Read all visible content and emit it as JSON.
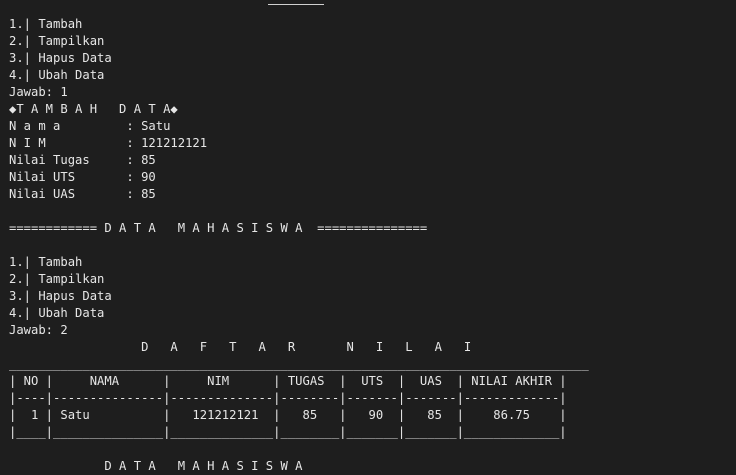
{
  "terminal": {
    "lines": [
      "1.| Tambah",
      "2.| Tampilkan",
      "3.| Hapus Data",
      "4.| Ubah Data",
      "Jawab: 1",
      "◆T A M B A H   D A T A◆",
      "N a m a         : Satu",
      "N I M           : 121212121",
      "Nilai Tugas     : 85",
      "Nilai UTS       : 90",
      "Nilai UAS       : 85",
      "",
      "============ D A T A   M A H A S I S W A  ===============",
      "",
      "1.| Tambah",
      "2.| Tampilkan",
      "3.| Hapus Data",
      "4.| Ubah Data",
      "Jawab: 2",
      "                  D   A   F   T   A   R       N   I   L   A   I",
      "_______________________________________________________________________________",
      "| NO |     NAMA      |     NIM      | TUGAS  |  UTS  |  UAS  | NILAI AKHIR |",
      "|----|---------------|--------------|--------|-------|-------|-------------|",
      "|  1 | Satu          |   121212121  |   85   |   90  |   85  |    86.75    |",
      "|____|_______________|______________|________|_______|_______|_____________|",
      "",
      "             D A T A   M A H A S I S W A"
    ]
  }
}
